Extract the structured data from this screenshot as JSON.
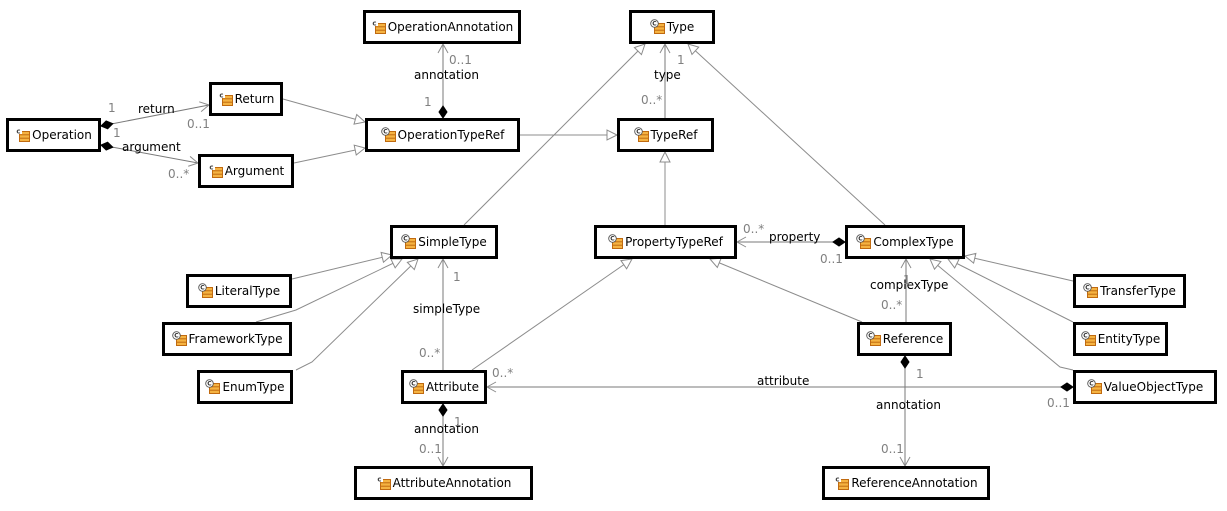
{
  "diagram": {
    "type": "uml-class-diagram",
    "colors": {
      "border": "#000000",
      "edge": "#8c8c8c",
      "icon_fill": "#f5b342",
      "icon_stroke": "#c06a10",
      "multiplicity": "#808080"
    },
    "classes": [
      {
        "id": "OperationAnnotation",
        "label": "OperationAnnotation",
        "icon": "class-icon",
        "abstract": false
      },
      {
        "id": "Type",
        "label": "Type",
        "icon": "abstract-class-icon",
        "abstract": true
      },
      {
        "id": "Return",
        "label": "Return",
        "icon": "class-icon",
        "abstract": false
      },
      {
        "id": "Operation",
        "label": "Operation",
        "icon": "class-icon",
        "abstract": false
      },
      {
        "id": "OperationTypeRef",
        "label": "OperationTypeRef",
        "icon": "abstract-class-icon",
        "abstract": true
      },
      {
        "id": "TypeRef",
        "label": "TypeRef",
        "icon": "abstract-class-icon",
        "abstract": true
      },
      {
        "id": "Argument",
        "label": "Argument",
        "icon": "class-icon",
        "abstract": false
      },
      {
        "id": "SimpleType",
        "label": "SimpleType",
        "icon": "abstract-class-icon",
        "abstract": true
      },
      {
        "id": "PropertyTypeRef",
        "label": "PropertyTypeRef",
        "icon": "abstract-class-icon",
        "abstract": true
      },
      {
        "id": "ComplexType",
        "label": "ComplexType",
        "icon": "abstract-class-icon",
        "abstract": true
      },
      {
        "id": "LiteralType",
        "label": "LiteralType",
        "icon": "abstract-class-icon",
        "abstract": true
      },
      {
        "id": "TransferType",
        "label": "TransferType",
        "icon": "abstract-class-icon",
        "abstract": true
      },
      {
        "id": "FrameworkType",
        "label": "FrameworkType",
        "icon": "abstract-class-icon",
        "abstract": true
      },
      {
        "id": "Reference",
        "label": "Reference",
        "icon": "abstract-class-icon",
        "abstract": true
      },
      {
        "id": "EntityType",
        "label": "EntityType",
        "icon": "abstract-class-icon",
        "abstract": true
      },
      {
        "id": "EnumType",
        "label": "EnumType",
        "icon": "abstract-class-icon",
        "abstract": true
      },
      {
        "id": "Attribute",
        "label": "Attribute",
        "icon": "abstract-class-icon",
        "abstract": true
      },
      {
        "id": "ValueObjectType",
        "label": "ValueObjectType",
        "icon": "abstract-class-icon",
        "abstract": true
      },
      {
        "id": "AttributeAnnotation",
        "label": "AttributeAnnotation",
        "icon": "class-icon",
        "abstract": false
      },
      {
        "id": "ReferenceAnnotation",
        "label": "ReferenceAnnotation",
        "icon": "class-icon",
        "abstract": false
      }
    ],
    "associations": [
      {
        "from": "Operation",
        "to": "Return",
        "kind": "composition",
        "role": "return",
        "source_mult": "1",
        "target_mult": "0..1"
      },
      {
        "from": "Operation",
        "to": "Argument",
        "kind": "composition",
        "role": "argument",
        "source_mult": "1",
        "target_mult": "0..*"
      },
      {
        "from": "OperationTypeRef",
        "to": "OperationAnnotation",
        "kind": "composition",
        "role": "annotation",
        "source_mult": "1",
        "target_mult": "0..1"
      },
      {
        "from": "TypeRef",
        "to": "Type",
        "kind": "reference",
        "role": "type",
        "source_mult": "0..*",
        "target_mult": "1"
      },
      {
        "from": "ComplexType",
        "to": "PropertyTypeRef",
        "kind": "composition",
        "role": "property",
        "source_mult": "0..1",
        "target_mult": "0..*"
      },
      {
        "from": "Reference",
        "to": "ComplexType",
        "kind": "reference",
        "role": "complexType",
        "source_mult": "0..*",
        "target_mult": "1"
      },
      {
        "from": "Attribute",
        "to": "SimpleType",
        "kind": "reference",
        "role": "simpleType",
        "source_mult": "0..*",
        "target_mult": "1"
      },
      {
        "from": "ValueObjectType",
        "to": "Attribute",
        "kind": "composition",
        "role": "attribute",
        "source_mult": "0..1",
        "target_mult": "0..*"
      },
      {
        "from": "Attribute",
        "to": "AttributeAnnotation",
        "kind": "composition",
        "role": "annotation",
        "source_mult": "1",
        "target_mult": "0..1"
      },
      {
        "from": "Reference",
        "to": "ReferenceAnnotation",
        "kind": "composition",
        "role": "annotation",
        "source_mult": "1",
        "target_mult": "0..1"
      }
    ],
    "generalizations": [
      {
        "child": "Return",
        "parent": "OperationTypeRef"
      },
      {
        "child": "Argument",
        "parent": "OperationTypeRef"
      },
      {
        "child": "OperationTypeRef",
        "parent": "TypeRef"
      },
      {
        "child": "PropertyTypeRef",
        "parent": "TypeRef"
      },
      {
        "child": "SimpleType",
        "parent": "Type"
      },
      {
        "child": "ComplexType",
        "parent": "Type"
      },
      {
        "child": "LiteralType",
        "parent": "SimpleType"
      },
      {
        "child": "FrameworkType",
        "parent": "SimpleType"
      },
      {
        "child": "EnumType",
        "parent": "SimpleType"
      },
      {
        "child": "Attribute",
        "parent": "PropertyTypeRef"
      },
      {
        "child": "Reference",
        "parent": "PropertyTypeRef"
      },
      {
        "child": "TransferType",
        "parent": "ComplexType"
      },
      {
        "child": "EntityType",
        "parent": "ComplexType"
      },
      {
        "child": "ValueObjectType",
        "parent": "ComplexType"
      }
    ]
  }
}
